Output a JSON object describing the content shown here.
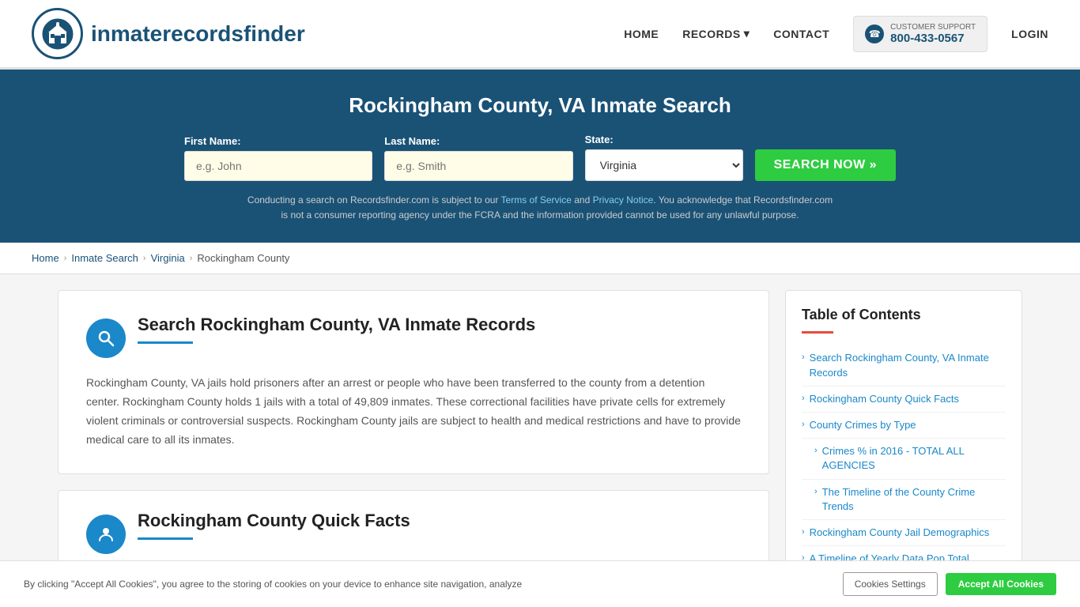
{
  "header": {
    "logo_text_regular": "inmaterecords",
    "logo_text_bold": "finder",
    "nav": {
      "home": "HOME",
      "records": "RECORDS",
      "contact": "CONTACT",
      "support_label": "CUSTOMER SUPPORT",
      "support_phone": "800-433-0567",
      "login": "LOGIN"
    }
  },
  "hero": {
    "title": "Rockingham County, VA Inmate Search",
    "form": {
      "first_name_label": "First Name:",
      "first_name_placeholder": "e.g. John",
      "last_name_label": "Last Name:",
      "last_name_placeholder": "e.g. Smith",
      "state_label": "State:",
      "state_value": "Virginia",
      "search_button": "SEARCH NOW »"
    },
    "disclaimer": "Conducting a search on Recordsfinder.com is subject to our Terms of Service and Privacy Notice. You acknowledge that Recordsfinder.com is not a consumer reporting agency under the FCRA and the information provided cannot be used for any unlawful purpose."
  },
  "breadcrumb": {
    "home": "Home",
    "inmate_search": "Inmate Search",
    "virginia": "Virginia",
    "current": "Rockingham County"
  },
  "main_section": {
    "title": "Search Rockingham County, VA Inmate Records",
    "body": "Rockingham County, VA jails hold prisoners after an arrest or people who have been transferred to the county from a detention center. Rockingham County holds 1 jails with a total of 49,809 inmates. These correctional facilities have private cells for extremely violent criminals or controversial suspects. Rockingham County jails are subject to health and medical restrictions and have to provide medical care to all its inmates."
  },
  "second_section": {
    "title": "Rockingham County Quick Facts"
  },
  "toc": {
    "title": "Table of Contents",
    "items": [
      {
        "label": "Search Rockingham County, VA Inmate Records",
        "sub": false
      },
      {
        "label": "Rockingham County Quick Facts",
        "sub": false
      },
      {
        "label": "County Crimes by Type",
        "sub": false
      },
      {
        "label": "Crimes % in 2016 - TOTAL ALL AGENCIES",
        "sub": true
      },
      {
        "label": "The Timeline of the County Crime Trends",
        "sub": true
      },
      {
        "label": "Rockingham County Jail Demographics",
        "sub": false
      },
      {
        "label": "A Timeline of Yearly Data Pop Total",
        "sub": false
      }
    ]
  },
  "cookie": {
    "text": "By clicking \"Accept All Cookies\", you agree to the storing of cookies on your device to enhance site navigation, analyze",
    "settings_label": "Cookies Settings",
    "accept_label": "Accept All Cookies"
  }
}
